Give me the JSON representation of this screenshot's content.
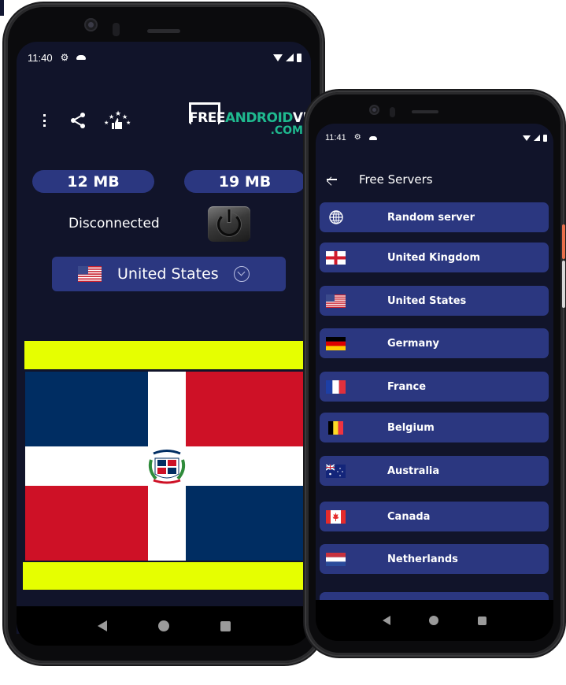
{
  "left_phone": {
    "status_bar": {
      "time": "11:40"
    },
    "toolbar": {
      "icons": [
        "menu-list-icon",
        "share-icon",
        "rate-stars-thumbs-up-icon"
      ]
    },
    "brand": {
      "free": "FREE",
      "android": "ANDROID",
      "vpn": "VPN",
      "com": ".COM"
    },
    "download_usage": "12 MB",
    "upload_usage": "19 MB",
    "connection_status": "Disconnected",
    "selected_country": {
      "name": "United States",
      "flag": "us-flag"
    },
    "ad_banner": {
      "flag": "dominican-republic-flag"
    },
    "colors": {
      "background": "#11142a",
      "accent": "#2b3780",
      "ad_yellow": "#e6ff00",
      "brand_green": "#1fb98f"
    }
  },
  "right_phone": {
    "status_bar": {
      "time": "11:41"
    },
    "header": {
      "title": "Free Servers"
    },
    "servers": [
      {
        "label": "Random server",
        "icon": "globe-icon"
      },
      {
        "label": "United Kingdom",
        "icon": "uk-flag"
      },
      {
        "label": "United States",
        "icon": "us-flag"
      },
      {
        "label": "Germany",
        "icon": "de-flag"
      },
      {
        "label": "France",
        "icon": "fr-flag"
      },
      {
        "label": "Belgium",
        "icon": "be-flag"
      },
      {
        "label": "Australia",
        "icon": "au-flag"
      },
      {
        "label": "Canada",
        "icon": "ca-flag"
      },
      {
        "label": "Netherlands",
        "icon": "nl-flag"
      },
      {
        "label": "",
        "icon": ""
      }
    ]
  }
}
